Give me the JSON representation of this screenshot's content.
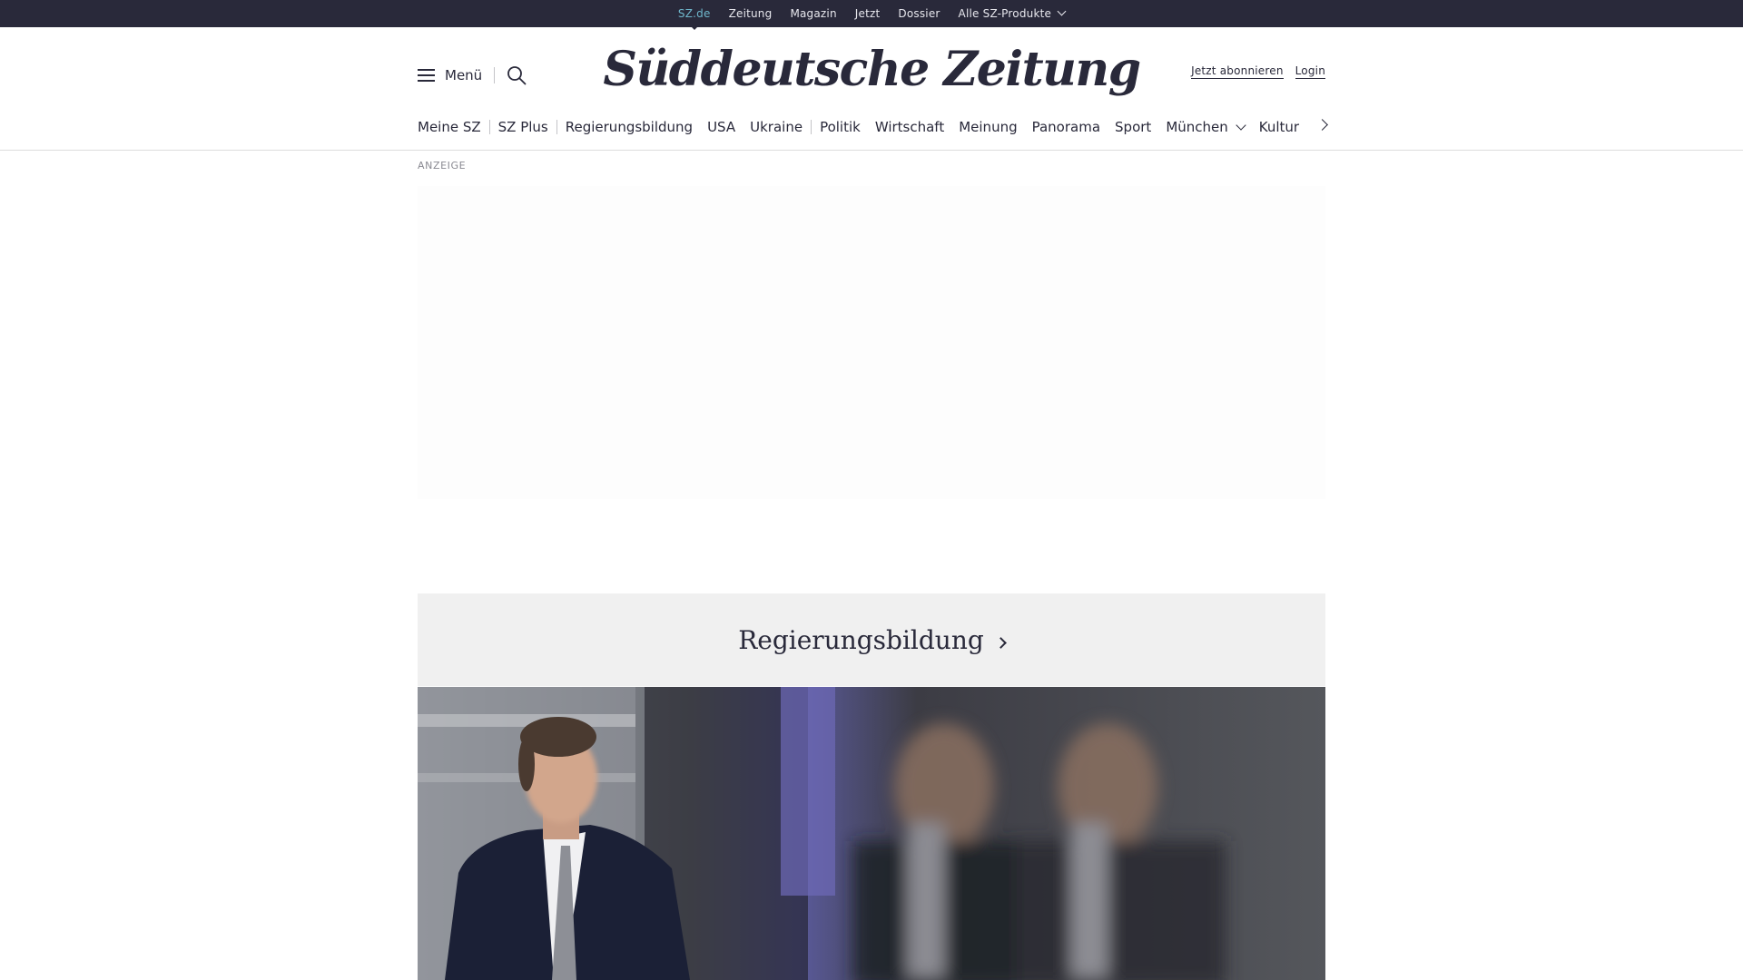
{
  "topbar": {
    "items": [
      {
        "label": "SZ.de"
      },
      {
        "label": "Zeitung"
      },
      {
        "label": "Magazin"
      },
      {
        "label": "Jetzt"
      },
      {
        "label": "Dossier"
      },
      {
        "label": "Alle SZ-Produkte"
      }
    ]
  },
  "header": {
    "menu_label": "Menü",
    "logo": "Süddeutsche Zeitung",
    "subscribe_label": "Jetzt abonnieren",
    "login_label": "Login"
  },
  "nav": {
    "items": [
      {
        "label": "Meine SZ"
      },
      {
        "label": "SZ Plus"
      },
      {
        "label": "Regierungsbildung"
      },
      {
        "label": "USA"
      },
      {
        "label": "Ukraine"
      },
      {
        "label": "Politik"
      },
      {
        "label": "Wirtschaft"
      },
      {
        "label": "Meinung"
      },
      {
        "label": "Panorama"
      },
      {
        "label": "Sport"
      },
      {
        "label": "München"
      },
      {
        "label": "Kultur"
      }
    ]
  },
  "ad": {
    "label": "ANZEIGE"
  },
  "section": {
    "title": "Regierungsbildung"
  },
  "colors": {
    "dark": "#29293a",
    "accent": "#6fb7cc",
    "section_bg": "#f0f0f0"
  }
}
